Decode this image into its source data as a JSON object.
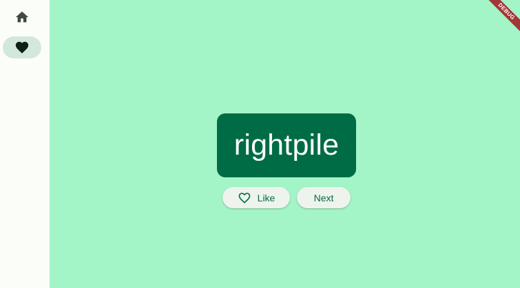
{
  "navigation_rail": {
    "destinations": [
      {
        "icon": "home-icon",
        "selected": false
      },
      {
        "icon": "heart-filled-icon",
        "selected": true
      }
    ]
  },
  "main": {
    "current_word": "rightpile",
    "like_button": {
      "label": "Like",
      "icon": "heart-outline-icon"
    },
    "next_button": {
      "label": "Next"
    }
  },
  "debug_banner": {
    "label": "DEBUG"
  },
  "colors": {
    "background": "#a3f4c6",
    "rail_background": "#fbfdf9",
    "rail_indicator": "#d3e8dc",
    "card": "#006c45",
    "button_background": "#eef3ee",
    "button_text": "#006c45",
    "banner": "#a33636"
  }
}
